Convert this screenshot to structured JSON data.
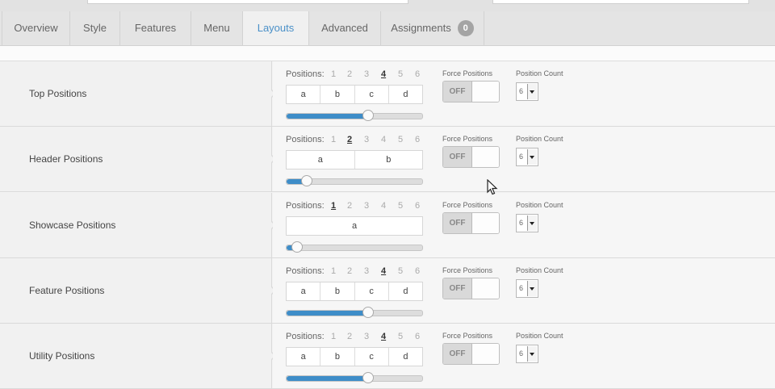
{
  "tabs": [
    {
      "label": "Overview"
    },
    {
      "label": "Style"
    },
    {
      "label": "Features"
    },
    {
      "label": "Menu"
    },
    {
      "label": "Layouts"
    },
    {
      "label": "Advanced"
    },
    {
      "label": "Assignments",
      "badge": "0"
    }
  ],
  "active_tab": "Layouts",
  "accent_color": "#3e8dc8",
  "rows": [
    {
      "label": "Top Positions",
      "positions_label": "Positions:",
      "numbers": [
        "1",
        "2",
        "3",
        "4",
        "5",
        "6"
      ],
      "selected": 4,
      "boxes": [
        "a",
        "b",
        "c",
        "d"
      ],
      "slider_level": 0.6,
      "force_label": "Force Positions",
      "toggle": "OFF",
      "count_label": "Position Count",
      "count_value": "6"
    },
    {
      "label": "Header Positions",
      "positions_label": "Positions:",
      "numbers": [
        "1",
        "2",
        "3",
        "4",
        "5",
        "6"
      ],
      "selected": 2,
      "boxes": [
        "a",
        "b"
      ],
      "slider_level": 0.15,
      "force_label": "Force Positions",
      "toggle": "OFF",
      "count_label": "Position Count",
      "count_value": "6"
    },
    {
      "label": "Showcase Positions",
      "positions_label": "Positions:",
      "numbers": [
        "1",
        "2",
        "3",
        "4",
        "5",
        "6"
      ],
      "selected": 1,
      "boxes": [
        "a"
      ],
      "slider_level": 0.08,
      "force_label": "Force Positions",
      "toggle": "OFF",
      "count_label": "Position Count",
      "count_value": "6"
    },
    {
      "label": "Feature Positions",
      "positions_label": "Positions:",
      "numbers": [
        "1",
        "2",
        "3",
        "4",
        "5",
        "6"
      ],
      "selected": 4,
      "boxes": [
        "a",
        "b",
        "c",
        "d"
      ],
      "slider_level": 0.6,
      "force_label": "Force Positions",
      "toggle": "OFF",
      "count_label": "Position Count",
      "count_value": "6"
    },
    {
      "label": "Utility Positions",
      "positions_label": "Positions:",
      "numbers": [
        "1",
        "2",
        "3",
        "4",
        "5",
        "6"
      ],
      "selected": 4,
      "boxes": [
        "a",
        "b",
        "c",
        "d"
      ],
      "slider_level": 0.6,
      "force_label": "Force Positions",
      "toggle": "OFF",
      "count_label": "Position Count",
      "count_value": "6"
    }
  ]
}
